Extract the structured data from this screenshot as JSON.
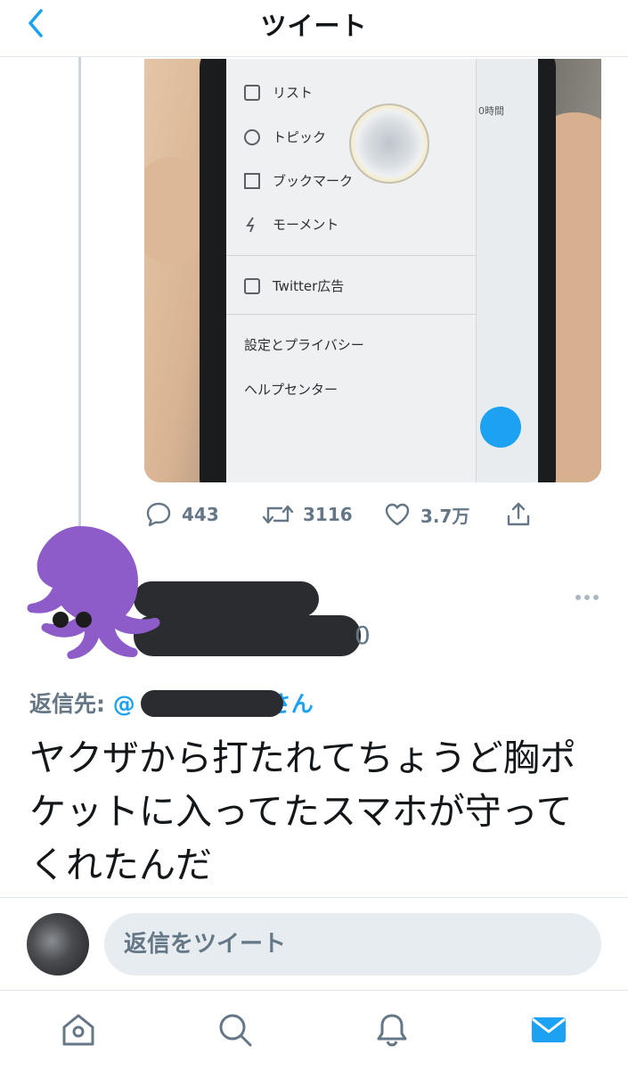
{
  "header": {
    "title": "ツイート",
    "back_icon": "chevron-left-icon"
  },
  "photo": {
    "menu": [
      "リスト",
      "トピック",
      "ブックマーク",
      "モーメント",
      "Twitter広告",
      "設定とプライバシー",
      "ヘルプセンター"
    ],
    "screen_time": "0時間"
  },
  "actions": {
    "replies": "443",
    "retweets": "3116",
    "likes": "3.7万",
    "reply_icon": "speech-bubble-icon",
    "retweet_icon": "retweet-icon",
    "like_icon": "heart-icon",
    "share_icon": "share-icon"
  },
  "reply_tweet": {
    "handle_visible_tail": "0",
    "reply_to_label": "返信先:",
    "mention_prefix": "@",
    "mention_suffix": "さん",
    "text": "ヤクザから打たれてちょうど胸ポケットに入ってたスマホが守ってくれたんだ",
    "avatar_icon": "octopus-icon"
  },
  "composer": {
    "placeholder": "返信をツイート"
  },
  "tabbar": {
    "items": [
      "home-icon",
      "search-icon",
      "bell-icon",
      "mail-icon"
    ],
    "active": "mail-icon"
  },
  "colors": {
    "accent": "#1da1f2",
    "muted": "#657786",
    "octopus": "#8e5cc8",
    "divider": "#e1e8ed"
  }
}
